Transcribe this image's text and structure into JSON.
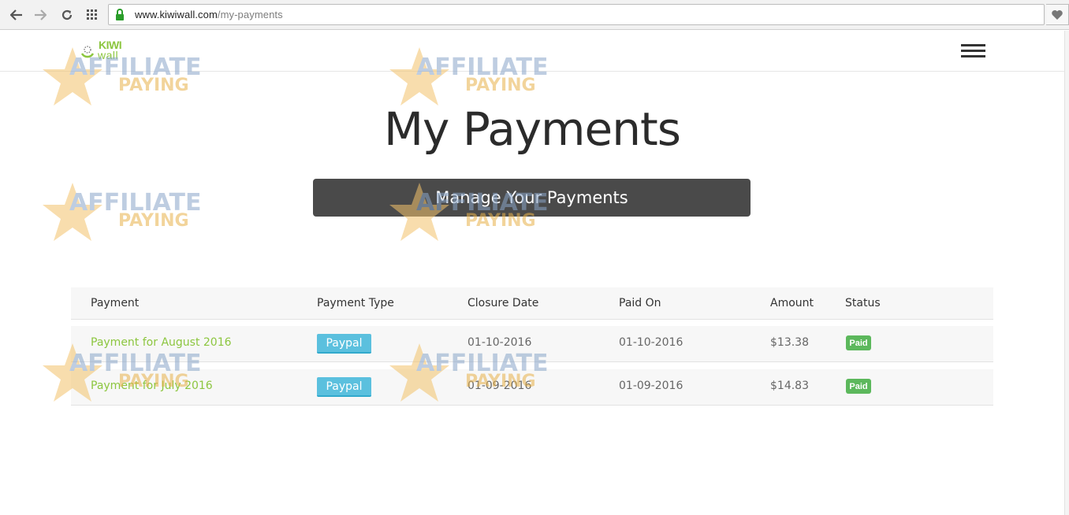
{
  "browser": {
    "url_host": "www.kiwiwall.com",
    "url_path": "/my-payments"
  },
  "header": {
    "logo_kiwi": "KIWI",
    "logo_wall": "wall"
  },
  "page": {
    "title": "My Payments",
    "banner": "Manage Your Payments"
  },
  "table": {
    "headers": [
      "Payment",
      "Payment Type",
      "Closure Date",
      "Paid On",
      "Amount",
      "Status"
    ],
    "rows": [
      {
        "payment": "Payment for August 2016",
        "type": "Paypal",
        "closure": "01-10-2016",
        "paid_on": "01-10-2016",
        "amount": "$13.38",
        "status": "Paid"
      },
      {
        "payment": "Payment for July 2016",
        "type": "Paypal",
        "closure": "01-09-2016",
        "paid_on": "01-09-2016",
        "amount": "$14.83",
        "status": "Paid"
      }
    ]
  },
  "watermark": {
    "line1": "AFFILIATE",
    "line2": "PAYING"
  },
  "colors": {
    "brand_green": "#8cc63f",
    "banner_bg": "#4a4a4a",
    "paypal_badge": "#5bc0de",
    "paid_badge": "#5cb85c"
  }
}
